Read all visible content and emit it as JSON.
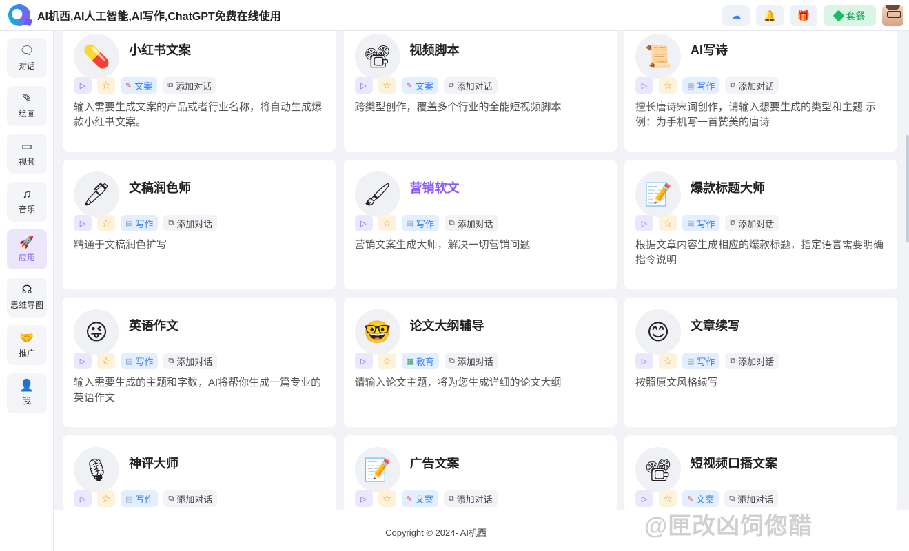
{
  "header": {
    "title": "AI机西,AI人工智能,AI写作,ChatGPT免费在线使用",
    "actions": [
      {
        "icon": "cloud-moon-icon",
        "glyph": "☁"
      },
      {
        "icon": "bell-icon",
        "glyph": "🔔"
      },
      {
        "icon": "gift-icon",
        "glyph": "🎁"
      }
    ],
    "plan_label": "套餐"
  },
  "sidebar": {
    "items": [
      {
        "label": "对话",
        "icon": "chat-icon",
        "glyph": "🗨",
        "active": false
      },
      {
        "label": "绘画",
        "icon": "brush-icon",
        "glyph": "✎",
        "active": false
      },
      {
        "label": "视频",
        "icon": "video-icon",
        "glyph": "▭",
        "active": false
      },
      {
        "label": "音乐",
        "icon": "music-icon",
        "glyph": "♫",
        "active": false
      },
      {
        "label": "应用",
        "icon": "rocket-icon",
        "glyph": "🚀",
        "active": true
      },
      {
        "label": "思维导图",
        "icon": "brain-icon",
        "glyph": "☊",
        "active": false
      },
      {
        "label": "推广",
        "icon": "handshake-icon",
        "glyph": "🤝",
        "active": false
      },
      {
        "label": "我",
        "icon": "user-icon",
        "glyph": "👤",
        "active": false
      }
    ]
  },
  "tag_labels": {
    "add": "添加对话"
  },
  "cards": [
    {
      "title": "小红书文案",
      "icon": "pill-icon",
      "glyph": "💊",
      "category": "文案",
      "cat_type": "copy",
      "desc": "输入需要生成文案的产品或者行业名称，将自动生成爆款小红书文案。"
    },
    {
      "title": "视频脚本",
      "icon": "projector-icon",
      "glyph": "📽",
      "category": "文案",
      "cat_type": "copy",
      "desc": "跨类型创作，覆盖多个行业的全能短视频脚本"
    },
    {
      "title": "AI写诗",
      "icon": "scroll-icon",
      "glyph": "📜",
      "category": "写作",
      "cat_type": "write",
      "desc": "擅长唐诗宋词创作，请输入想要生成的类型和主题 示例：为手机写一首赞美的唐诗"
    },
    {
      "title": "文稿润色师",
      "icon": "pen-icon",
      "glyph": "🖊",
      "category": "写作",
      "cat_type": "write",
      "desc": "精通于文稿润色扩写"
    },
    {
      "title": "营销软文",
      "icon": "paintbrush-icon",
      "glyph": "🖌",
      "category": "写作",
      "cat_type": "write",
      "desc": "营销文案生成大师，解决一切营销问题",
      "highlight": true
    },
    {
      "title": "爆款标题大师",
      "icon": "memo-icon",
      "glyph": "📝",
      "category": "写作",
      "cat_type": "write",
      "desc": "根据文章内容生成相应的爆款标题，指定语言需要明确指令说明"
    },
    {
      "title": "英语作文",
      "icon": "winking-face-icon",
      "glyph": "😜",
      "category": "写作",
      "cat_type": "write",
      "desc": "输入需要生成的主题和字数，AI将帮你生成一篇专业的英语作文"
    },
    {
      "title": "论文大纲辅导",
      "icon": "nerd-face-icon",
      "glyph": "🤓",
      "category": "教育",
      "cat_type": "edu",
      "desc": "请输入论文主题，将为您生成详细的论文大纲"
    },
    {
      "title": "文章续写",
      "icon": "smiling-face-icon",
      "glyph": "😊",
      "category": "写作",
      "cat_type": "write",
      "desc": "按照原文风格续写"
    },
    {
      "title": "神评大师",
      "icon": "microphone-icon",
      "glyph": "🎙",
      "category": "写作",
      "cat_type": "write",
      "desc": ""
    },
    {
      "title": "广告文案",
      "icon": "memo-icon",
      "glyph": "📝",
      "category": "文案",
      "cat_type": "copy",
      "desc": ""
    },
    {
      "title": "短视频口播文案",
      "icon": "projector-icon",
      "glyph": "📽",
      "category": "文案",
      "cat_type": "copy",
      "desc": ""
    }
  ],
  "footer": {
    "copyright": "Copyright © 2024-  AI机西"
  },
  "watermark": "@匣改凶饲偬醋"
}
